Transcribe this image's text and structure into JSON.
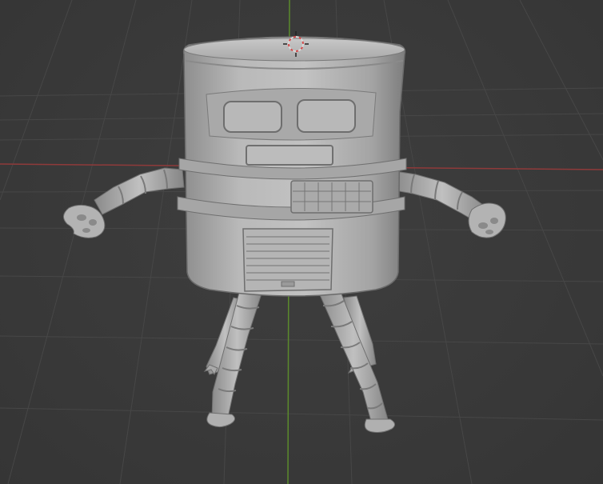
{
  "viewport": {
    "type": "3d-viewport",
    "background_color": "#393939",
    "grid_color": "#4a4a4a",
    "x_axis_color": "#9a3b3b",
    "y_axis_color": "#5e8a2a",
    "model_color": "#b4b4b4"
  },
  "scene": {
    "object": "robot-barrel-sculpt",
    "cursor_icon": "3d-cursor-icon"
  }
}
